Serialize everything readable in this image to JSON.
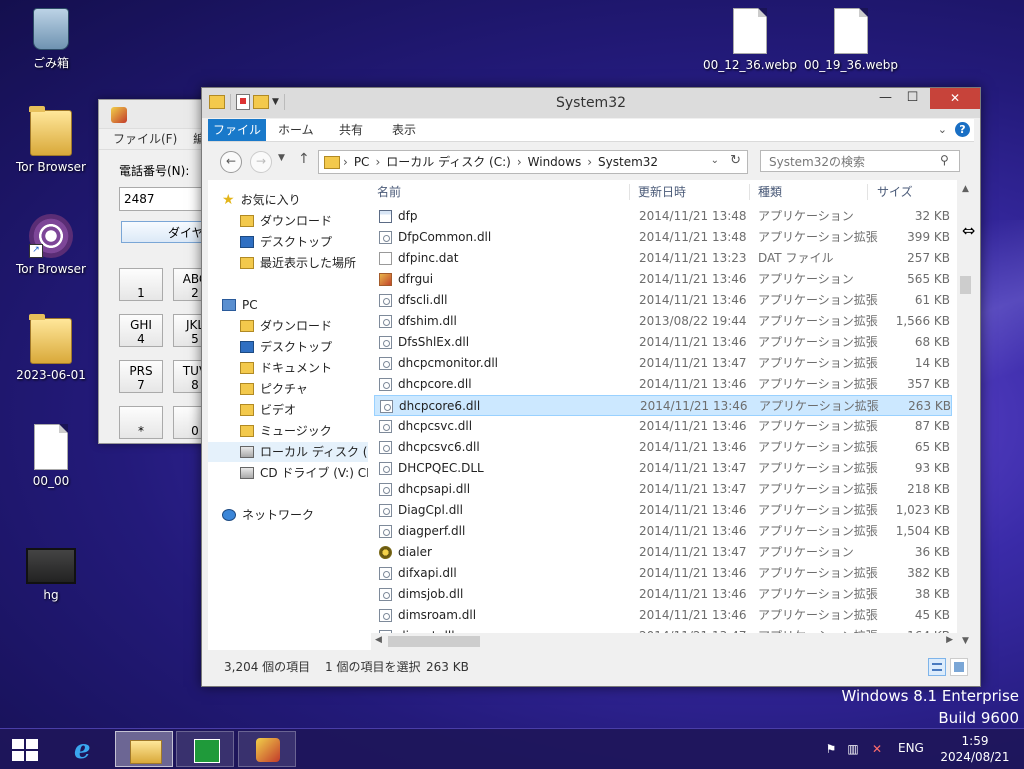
{
  "desktop": {
    "icons": [
      {
        "label": "ごみ箱",
        "icon": "recycle-bin-icon"
      },
      {
        "label": "Tor Browser",
        "icon": "folder-icon"
      },
      {
        "label": "Tor Browser",
        "icon": "tor-browser-icon"
      },
      {
        "label": "2023-06-01",
        "icon": "folder-icon"
      },
      {
        "label": "00_00",
        "icon": "document-icon"
      },
      {
        "label": "hg",
        "icon": "video-file-icon"
      },
      {
        "label": "00_12_36.webp",
        "icon": "document-icon"
      },
      {
        "label": "00_19_36.webp",
        "icon": "document-icon"
      }
    ]
  },
  "dialer": {
    "menu": [
      "ファイル(F)",
      "編集"
    ],
    "phone_label": "電話番号(N):",
    "phone_value": "2487",
    "dial_button": "ダイヤル",
    "keys": [
      {
        "top": "",
        "bottom": "1"
      },
      {
        "top": "ABC",
        "bottom": "2"
      },
      {
        "top": "GHI",
        "bottom": "4"
      },
      {
        "top": "JKL",
        "bottom": "5"
      },
      {
        "top": "PRS",
        "bottom": "7"
      },
      {
        "top": "TUV",
        "bottom": "8"
      },
      {
        "top": "",
        "bottom": "*"
      },
      {
        "top": "",
        "bottom": "0"
      }
    ]
  },
  "explorer": {
    "title": "System32",
    "window_buttons": {
      "minimize": "—",
      "maximize": "☐",
      "close": "✕"
    },
    "ribbon_tabs": [
      "ファイル",
      "ホーム",
      "共有",
      "表示"
    ],
    "address": [
      "PC",
      "ローカル ディスク (C:)",
      "Windows",
      "System32"
    ],
    "search_placeholder": "System32の検索",
    "nav_pane": {
      "favorites": "お気に入り",
      "favorites_items": [
        "ダウンロード",
        "デスクトップ",
        "最近表示した場所"
      ],
      "pc": "PC",
      "pc_items": [
        "ダウンロード",
        "デスクトップ",
        "ドキュメント",
        "ピクチャ",
        "ビデオ",
        "ミュージック",
        "ローカル ディスク (C:)",
        "CD ドライブ (V:) CDF"
      ],
      "network": "ネットワーク"
    },
    "columns": {
      "name": "名前",
      "date": "更新日時",
      "type": "種類",
      "size": "サイズ"
    },
    "files": [
      {
        "name": "dfp",
        "date": "2014/11/21 13:48",
        "type": "アプリケーション",
        "size": "32 KB",
        "icon": "app"
      },
      {
        "name": "DfpCommon.dll",
        "date": "2014/11/21 13:48",
        "type": "アプリケーション拡張",
        "size": "399 KB",
        "icon": "dll"
      },
      {
        "name": "dfpinc.dat",
        "date": "2014/11/21 13:23",
        "type": "DAT ファイル",
        "size": "257 KB",
        "icon": "dat"
      },
      {
        "name": "dfrgui",
        "date": "2014/11/21 13:46",
        "type": "アプリケーション",
        "size": "565 KB",
        "icon": "app2"
      },
      {
        "name": "dfscli.dll",
        "date": "2014/11/21 13:46",
        "type": "アプリケーション拡張",
        "size": "61 KB",
        "icon": "dll"
      },
      {
        "name": "dfshim.dll",
        "date": "2013/08/22 19:44",
        "type": "アプリケーション拡張",
        "size": "1,566 KB",
        "icon": "dll"
      },
      {
        "name": "DfsShlEx.dll",
        "date": "2014/11/21 13:46",
        "type": "アプリケーション拡張",
        "size": "68 KB",
        "icon": "dll"
      },
      {
        "name": "dhcpcmonitor.dll",
        "date": "2014/11/21 13:47",
        "type": "アプリケーション拡張",
        "size": "14 KB",
        "icon": "dll"
      },
      {
        "name": "dhcpcore.dll",
        "date": "2014/11/21 13:46",
        "type": "アプリケーション拡張",
        "size": "357 KB",
        "icon": "dll"
      },
      {
        "name": "dhcpcore6.dll",
        "date": "2014/11/21 13:46",
        "type": "アプリケーション拡張",
        "size": "263 KB",
        "icon": "dll",
        "selected": true
      },
      {
        "name": "dhcpcsvc.dll",
        "date": "2014/11/21 13:46",
        "type": "アプリケーション拡張",
        "size": "87 KB",
        "icon": "dll"
      },
      {
        "name": "dhcpcsvc6.dll",
        "date": "2014/11/21 13:46",
        "type": "アプリケーション拡張",
        "size": "65 KB",
        "icon": "dll"
      },
      {
        "name": "DHCPQEC.DLL",
        "date": "2014/11/21 13:47",
        "type": "アプリケーション拡張",
        "size": "93 KB",
        "icon": "dll"
      },
      {
        "name": "dhcpsapi.dll",
        "date": "2014/11/21 13:47",
        "type": "アプリケーション拡張",
        "size": "218 KB",
        "icon": "dll"
      },
      {
        "name": "DiagCpl.dll",
        "date": "2014/11/21 13:46",
        "type": "アプリケーション拡張",
        "size": "1,023 KB",
        "icon": "dll"
      },
      {
        "name": "diagperf.dll",
        "date": "2014/11/21 13:46",
        "type": "アプリケーション拡張",
        "size": "1,504 KB",
        "icon": "dll"
      },
      {
        "name": "dialer",
        "date": "2014/11/21 13:47",
        "type": "アプリケーション",
        "size": "36 KB",
        "icon": "app3"
      },
      {
        "name": "difxapi.dll",
        "date": "2014/11/21 13:46",
        "type": "アプリケーション拡張",
        "size": "382 KB",
        "icon": "dll"
      },
      {
        "name": "dimsjob.dll",
        "date": "2014/11/21 13:46",
        "type": "アプリケーション拡張",
        "size": "38 KB",
        "icon": "dll"
      },
      {
        "name": "dimsroam.dll",
        "date": "2014/11/21 13:46",
        "type": "アプリケーション拡張",
        "size": "45 KB",
        "icon": "dll"
      },
      {
        "name": "dinput.dll",
        "date": "2014/11/21 13:47",
        "type": "アプリケーション拡張",
        "size": "164 KB",
        "icon": "dll"
      }
    ],
    "status": {
      "count": "3,204 個の項目",
      "selection": "1 個の項目を選択",
      "selection_size": "263 KB"
    }
  },
  "watermark": {
    "line1": "Windows 8.1 Enterprise",
    "line2": "Build 9600"
  },
  "taskbar": {
    "language": "ENG",
    "time": "1:59",
    "date": "2024/08/21"
  }
}
